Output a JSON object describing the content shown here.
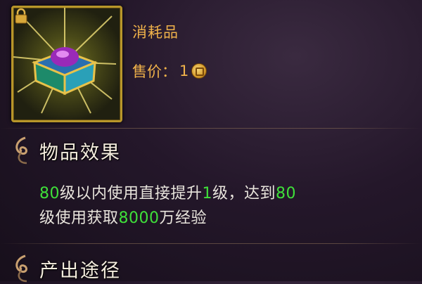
{
  "item": {
    "type_label": "消耗品",
    "price_label": "售价：",
    "price_value": "1",
    "icon": "treasure-chest-icon",
    "locked": true
  },
  "effect_section": {
    "title": "物品效果",
    "line1": {
      "p1": "80",
      "p2": "级以内使用直接提升",
      "p3": "1",
      "p4": "级，达到",
      "p5": "80"
    },
    "line2": {
      "p1": "级使用获取",
      "p2": "8000",
      "p3": "万经验"
    }
  },
  "source_section": {
    "title": "产出途径"
  },
  "colors": {
    "gold_text": "#f0b24a",
    "highlight_green": "#3fe03a",
    "frame_gold": "#b8962a"
  }
}
